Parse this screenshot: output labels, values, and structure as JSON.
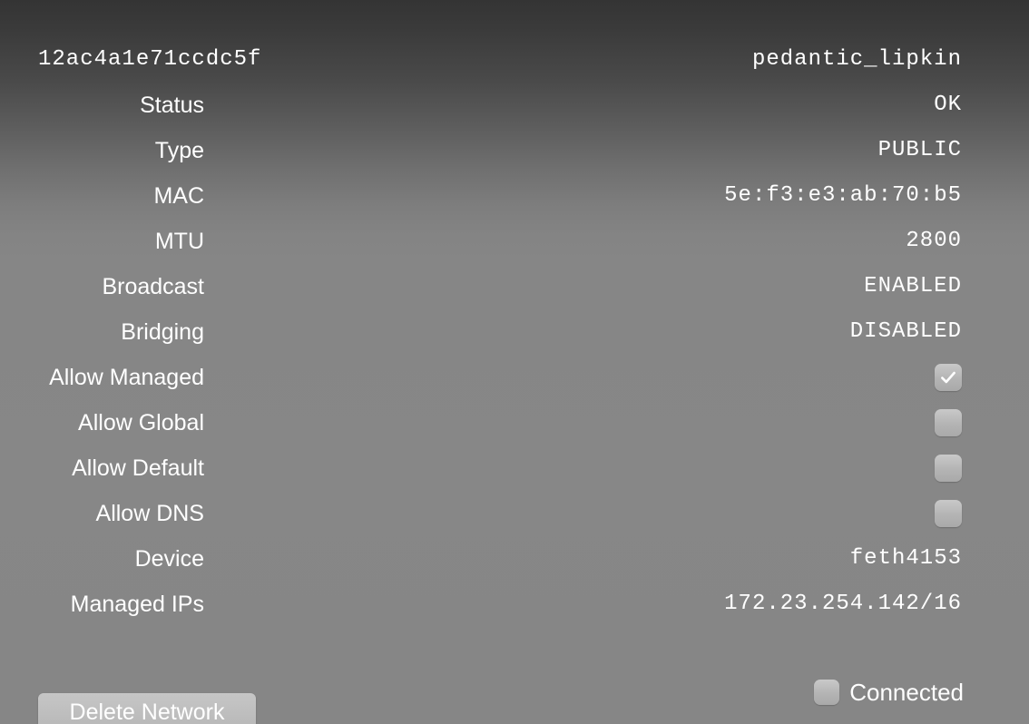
{
  "window": {
    "background_top_color": "#343434",
    "background_bottom_color": "#868686",
    "text_color": "#ffffff"
  },
  "header": {
    "network_id": "12ac4a1e71ccdc5f",
    "network_name": "pedantic_lipkin"
  },
  "rows": [
    {
      "label": "12ac4a1e71ccdc5f",
      "label_mono": true,
      "value": "pedantic_lipkin",
      "kind": "text"
    },
    {
      "label": "Status",
      "label_mono": false,
      "value": "OK",
      "kind": "text"
    },
    {
      "label": "Type",
      "label_mono": false,
      "value": "PUBLIC",
      "kind": "text"
    },
    {
      "label": "MAC",
      "label_mono": false,
      "value": "5e:f3:e3:ab:70:b5",
      "kind": "text"
    },
    {
      "label": "MTU",
      "label_mono": false,
      "value": "2800",
      "kind": "text"
    },
    {
      "label": "Broadcast",
      "label_mono": false,
      "value": "ENABLED",
      "kind": "text"
    },
    {
      "label": "Bridging",
      "label_mono": false,
      "value": "DISABLED",
      "kind": "text"
    },
    {
      "label": "Allow Managed",
      "label_mono": false,
      "value": "",
      "kind": "checkbox",
      "checked": true
    },
    {
      "label": "Allow Global",
      "label_mono": false,
      "value": "",
      "kind": "checkbox",
      "checked": false
    },
    {
      "label": "Allow Default",
      "label_mono": false,
      "value": "",
      "kind": "checkbox",
      "checked": false
    },
    {
      "label": "Allow DNS",
      "label_mono": false,
      "value": "",
      "kind": "checkbox",
      "checked": false
    },
    {
      "label": "Device",
      "label_mono": false,
      "value": "feth4153",
      "kind": "text"
    },
    {
      "label": "Managed IPs",
      "label_mono": false,
      "value": "172.23.254.142/16",
      "kind": "text"
    }
  ],
  "footer": {
    "delete_button_label": "Delete Network",
    "connected_label": "Connected",
    "connected_checked": false
  }
}
